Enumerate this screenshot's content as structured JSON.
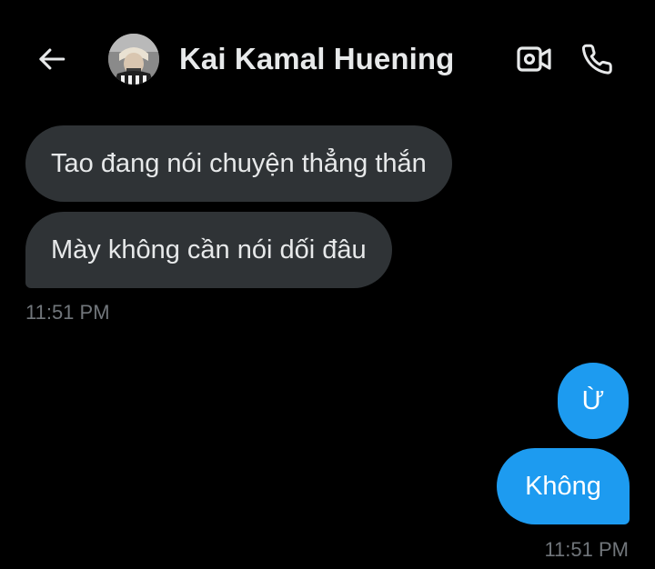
{
  "header": {
    "back_icon": "arrow-left-icon",
    "name": "Kai Kamal Huening",
    "video_icon": "video-camera-icon",
    "call_icon": "phone-icon"
  },
  "messages": [
    {
      "direction": "received",
      "text": "Tao đang nói chuyện thẳng thắn"
    },
    {
      "direction": "received",
      "text": "Mày không cần nói dối đâu"
    },
    {
      "direction": "sent",
      "text": "Ừ"
    },
    {
      "direction": "sent",
      "text": "Không"
    }
  ],
  "timestamps": {
    "received": "11:51 PM",
    "sent": "11:51 PM"
  },
  "colors": {
    "background": "#000000",
    "received_bubble": "#2f3336",
    "sent_bubble": "#1d9bf0",
    "timestamp": "#71767b"
  }
}
